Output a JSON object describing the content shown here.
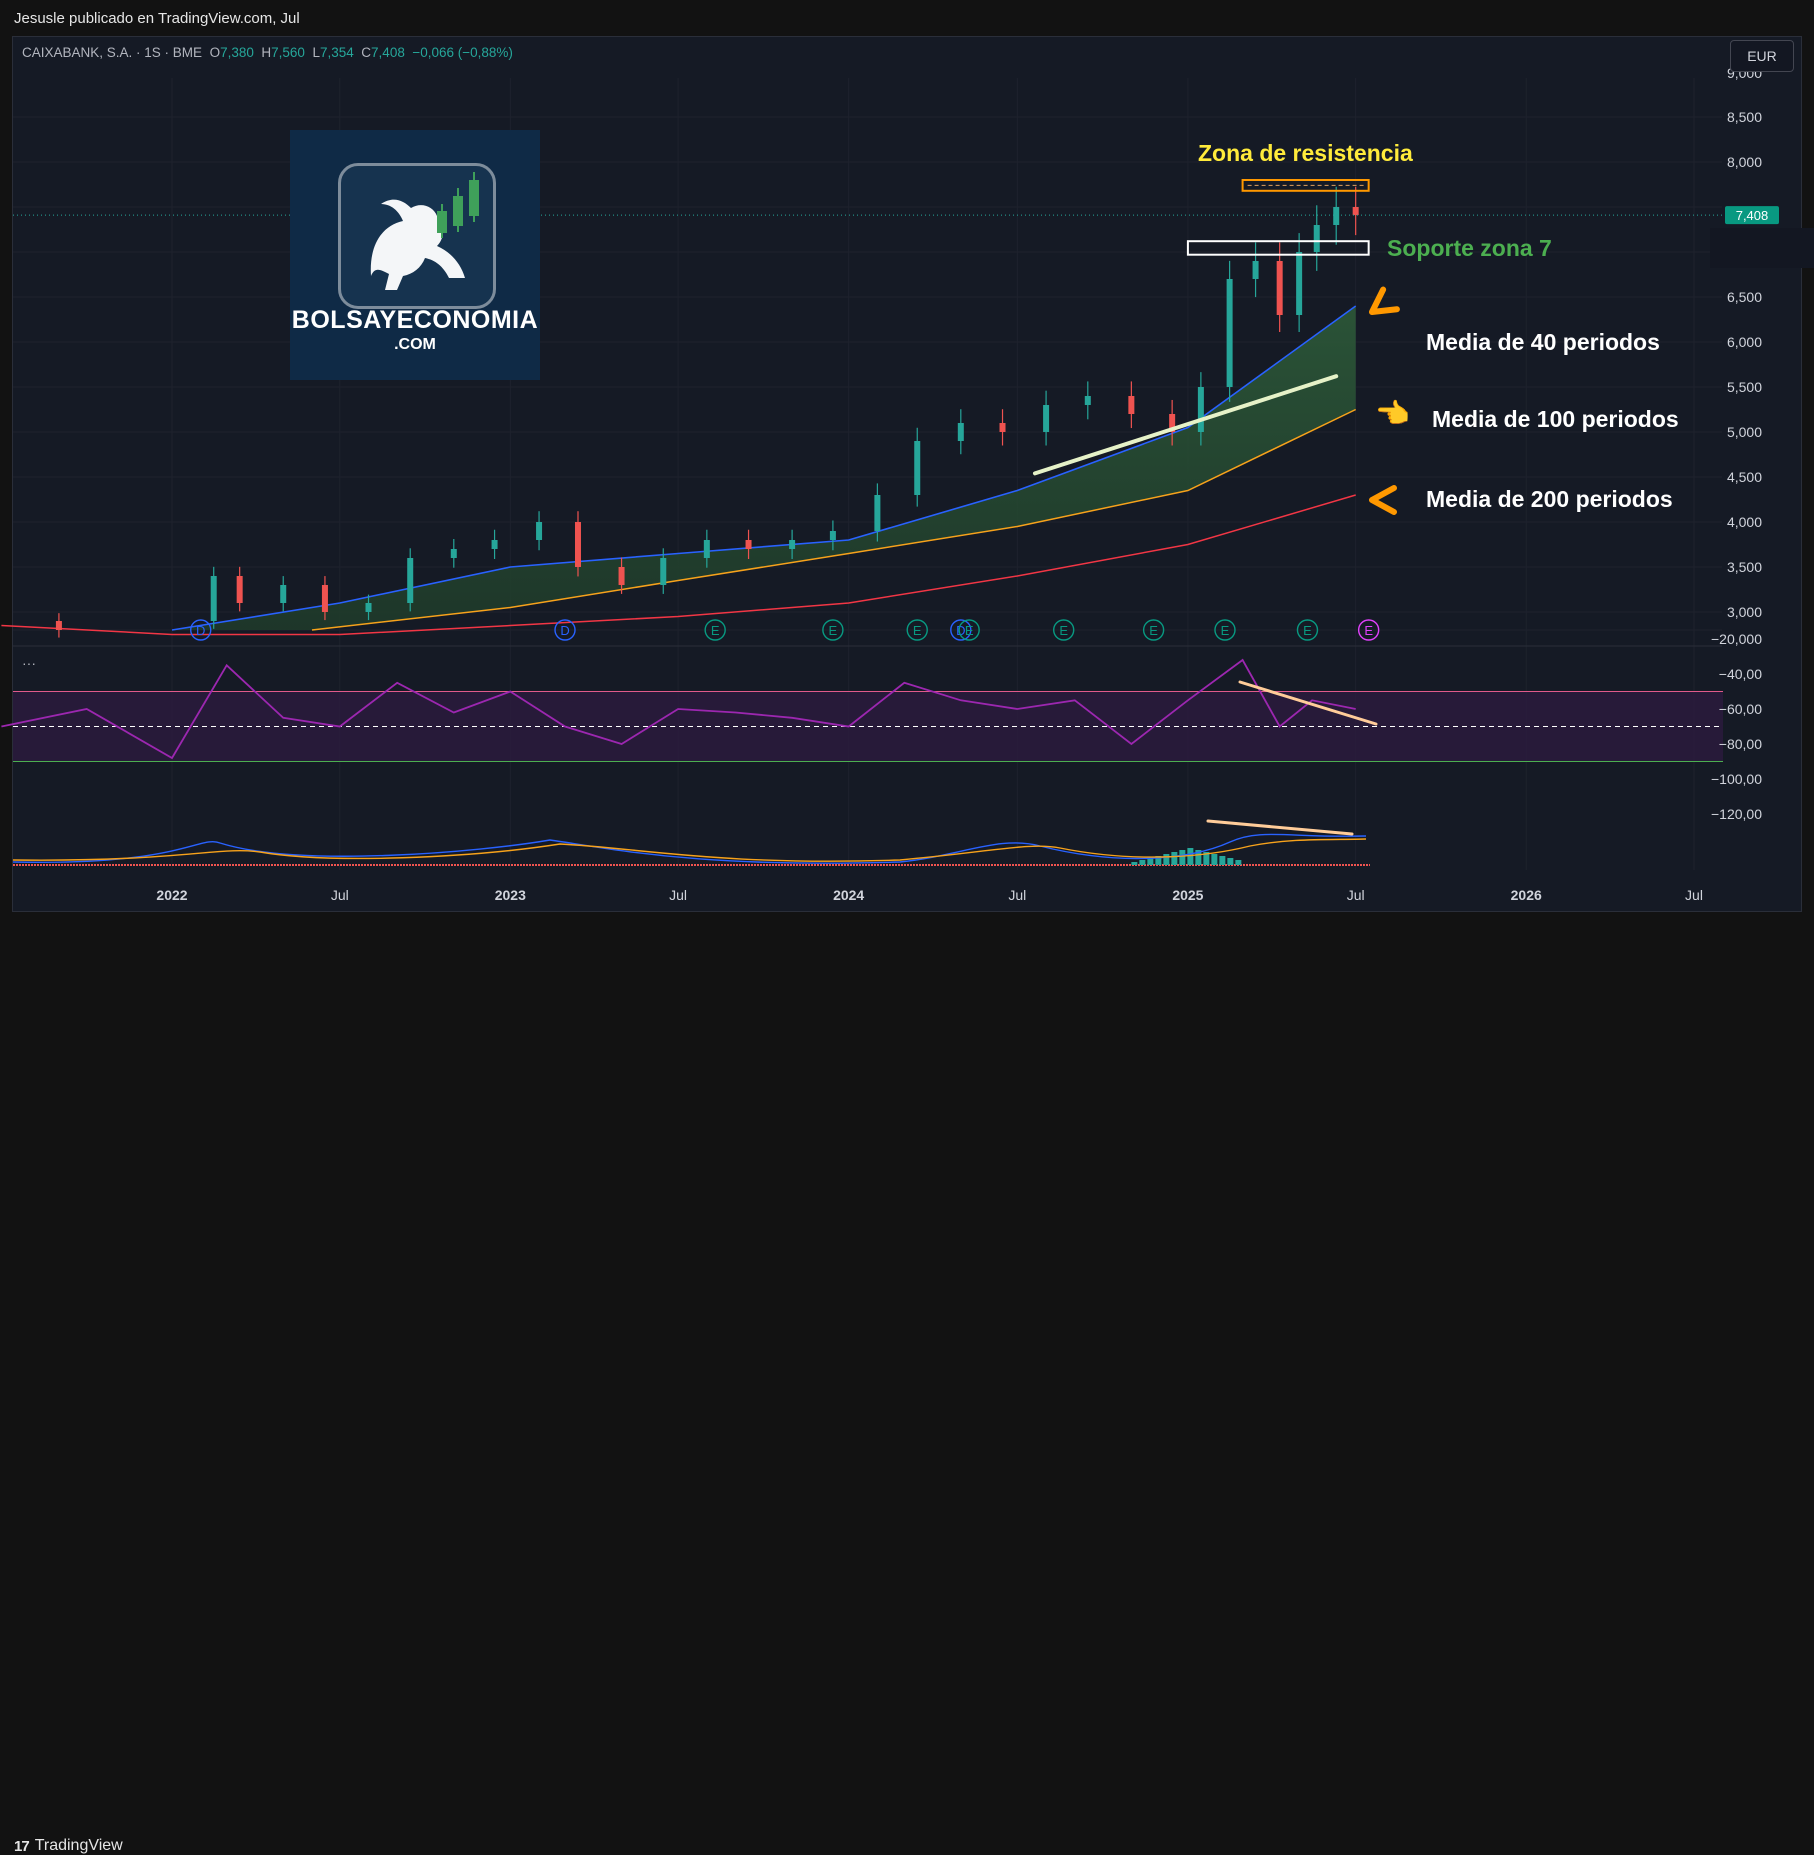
{
  "header": {
    "publisher": "Jesusle publicado en TradingView.com, Jul"
  },
  "legend": {
    "symbol": "CAIXABANK, S.A. · 1S · BME",
    "o_label": "O",
    "o_value": "7,380",
    "h_label": "H",
    "h_value": "7,560",
    "l_label": "L",
    "l_value": "7,354",
    "c_label": "C",
    "c_value": "7,408",
    "change": "−0,066 (−0,88%)"
  },
  "currency_button": "EUR",
  "indicator_menu": "···",
  "footer": {
    "brand": "TradingView",
    "brand_mark": "17"
  },
  "logo": {
    "name": "BOLSAYECONOMIA",
    "suffix": ".COM"
  },
  "annotations": {
    "resistance": "Zona de resistencia",
    "support": "Soporte zona 7",
    "ma40": "Media de 40 periodos",
    "ma100": "Media de 100 periodos",
    "ma200": "Media de 200 periodos"
  },
  "colors": {
    "up": "#26a69a",
    "down": "#ef5350",
    "ma40": "#2962ff",
    "ma100": "#f7a21b",
    "ma200": "#f23645",
    "rsi": "#9c27b0",
    "annotation_yellow": "#ffeb3b",
    "annotation_green": "#4caf50",
    "arrow_orange": "#ff9800"
  },
  "chart_data": [
    {
      "type": "candlestick",
      "title": "CAIXABANK, S.A. · 1S · BME",
      "x_ticks": [
        "2022",
        "Jul",
        "2023",
        "Jul",
        "2024",
        "Jul",
        "2025",
        "Jul",
        "2026",
        "Jul"
      ],
      "x_tick_dates": [
        "2022-01-01",
        "2022-07-01",
        "2023-01-01",
        "2023-07-01",
        "2024-01-01",
        "2024-07-01",
        "2025-01-01",
        "2025-07-01",
        "2026-01-01",
        "2026-07-01"
      ],
      "y_ticks": [
        "3,000",
        "3,500",
        "4,000",
        "4,500",
        "5,000",
        "5,500",
        "6,000",
        "6,500",
        "8,000",
        "8,500"
      ],
      "ylim": [
        2.8,
        9.0
      ],
      "last_price": "7,408",
      "series": [
        {
          "name": "price_close",
          "x": [
            "2021-07-01",
            "2021-09-01",
            "2021-11-01",
            "2022-01-01",
            "2022-02-15",
            "2022-03-15",
            "2022-05-01",
            "2022-06-15",
            "2022-08-01",
            "2022-09-15",
            "2022-11-01",
            "2022-12-15",
            "2023-02-01",
            "2023-03-15",
            "2023-05-01",
            "2023-06-15",
            "2023-08-01",
            "2023-09-15",
            "2023-11-01",
            "2023-12-15",
            "2024-02-01",
            "2024-03-15",
            "2024-05-01",
            "2024-06-15",
            "2024-08-01",
            "2024-09-15",
            "2024-11-01",
            "2024-12-15",
            "2025-01-15",
            "2025-02-15",
            "2025-03-15",
            "2025-04-10",
            "2025-05-01",
            "2025-05-20",
            "2025-06-10",
            "2025-07-01"
          ],
          "values": [
            2.9,
            2.8,
            2.6,
            2.9,
            3.4,
            3.1,
            3.3,
            3.0,
            3.1,
            3.6,
            3.7,
            3.8,
            4.0,
            3.5,
            3.3,
            3.6,
            3.8,
            3.7,
            3.8,
            3.9,
            4.3,
            4.9,
            5.1,
            5.0,
            5.3,
            5.4,
            5.2,
            5.0,
            5.5,
            6.7,
            6.9,
            6.3,
            7.0,
            7.3,
            7.5,
            7.41
          ]
        },
        {
          "name": "ma40",
          "x": [
            "2022-01-01",
            "2022-07-01",
            "2023-01-01",
            "2023-07-01",
            "2024-01-01",
            "2024-07-01",
            "2025-01-01",
            "2025-07-01"
          ],
          "values": [
            2.8,
            3.1,
            3.5,
            3.65,
            3.8,
            4.35,
            5.05,
            6.4
          ]
        },
        {
          "name": "ma100",
          "x": [
            "2022-06-01",
            "2023-01-01",
            "2023-07-01",
            "2024-01-01",
            "2024-07-01",
            "2025-01-01",
            "2025-07-01"
          ],
          "values": [
            2.8,
            3.05,
            3.35,
            3.65,
            3.95,
            4.35,
            5.25
          ]
        },
        {
          "name": "ma200",
          "x": [
            "2021-07-01",
            "2022-01-01",
            "2022-07-01",
            "2023-01-01",
            "2023-07-01",
            "2024-01-01",
            "2024-07-01",
            "2025-01-01",
            "2025-07-01"
          ],
          "values": [
            2.85,
            2.75,
            2.75,
            2.85,
            2.95,
            3.1,
            3.4,
            3.75,
            4.3
          ]
        }
      ],
      "zones": [
        {
          "name": "resistance",
          "from": 7.68,
          "to": 7.8,
          "x": [
            "2025-03-01",
            "2025-07-15"
          ]
        },
        {
          "name": "support",
          "from": 6.97,
          "to": 7.12,
          "x": [
            "2025-01-01",
            "2025-07-15"
          ]
        }
      ],
      "event_markers": [
        "D",
        "D",
        "E",
        "E",
        "E",
        "D",
        "E",
        "E",
        "E",
        "E",
        "E",
        "E"
      ]
    },
    {
      "type": "line",
      "title": "",
      "y_ticks": [
        "−20,000",
        "−40,00",
        "−60,00",
        "−80,00",
        "−100,00",
        "−120,00"
      ],
      "band": [
        -50,
        -90
      ],
      "midline": -70,
      "series": [
        {
          "name": "",
          "x": [
            "2021-07-01",
            "2021-10-01",
            "2022-01-01",
            "2022-03-01",
            "2022-05-01",
            "2022-07-01",
            "2022-09-01",
            "2022-11-01",
            "2023-01-01",
            "2023-03-01",
            "2023-05-01",
            "2023-07-01",
            "2023-09-01",
            "2023-11-01",
            "2024-01-01",
            "2024-03-01",
            "2024-05-01",
            "2024-07-01",
            "2024-09-01",
            "2024-11-01",
            "2025-01-01",
            "2025-03-01",
            "2025-04-10",
            "2025-05-15",
            "2025-07-01"
          ],
          "values": [
            -70,
            -60,
            -88,
            -35,
            -65,
            -70,
            -45,
            -62,
            -50,
            -70,
            -80,
            -60,
            -62,
            -65,
            -70,
            -45,
            -55,
            -60,
            -55,
            -80,
            -55,
            -32,
            -70,
            -55,
            -60
          ]
        }
      ]
    },
    {
      "type": "bar",
      "title": "",
      "description_series": [
        "histogram",
        "macd",
        "signal"
      ],
      "y_ticks": [
        "−100,00",
        "−120,00"
      ]
    }
  ]
}
